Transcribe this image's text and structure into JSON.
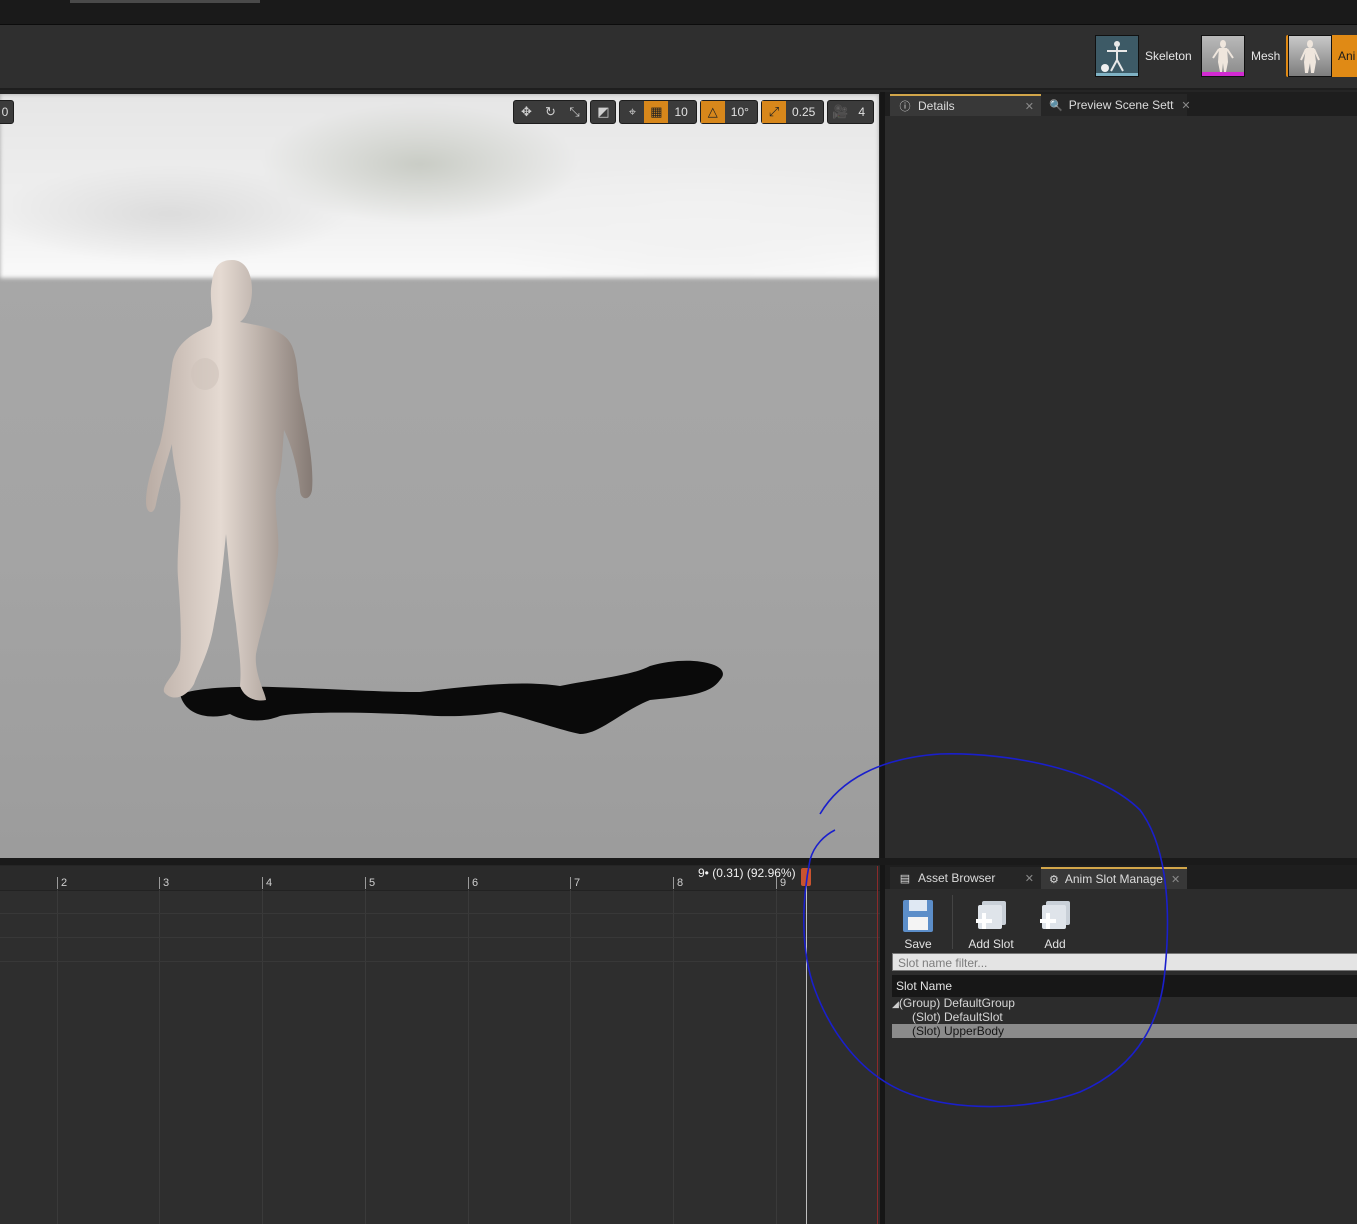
{
  "toolbar": {
    "modes": [
      {
        "label": "Skeleton",
        "icon": "skeleton-icon"
      },
      {
        "label": "Mesh",
        "icon": "mesh-icon"
      },
      {
        "label": "Ani",
        "icon": "animation-icon"
      }
    ]
  },
  "viewport": {
    "left_tag": "0",
    "grid_snap": "10",
    "rotation_snap": "10°",
    "scale_snap": "0.25",
    "camera_speed": "4"
  },
  "details_panel": {
    "tabs": [
      {
        "label": "Details",
        "icon": "info-icon"
      },
      {
        "label": "Preview Scene Sett",
        "icon": "search-icon"
      }
    ]
  },
  "timeline": {
    "ticks": [
      "2",
      "3",
      "4",
      "5",
      "6",
      "7",
      "8",
      "9"
    ],
    "frame_readout": "9• (0.31) (92.96%)"
  },
  "slot_panel": {
    "tabs": [
      {
        "label": "Asset Browser",
        "icon": "asset-browser-icon"
      },
      {
        "label": "Anim Slot Manage",
        "icon": "slot-manager-icon"
      }
    ],
    "buttons": {
      "save": "Save",
      "add_slot": "Add Slot",
      "add_group": "Add Group"
    },
    "filter_placeholder": "Slot name filter...",
    "column_header": "Slot Name",
    "tree": {
      "group": "(Group) DefaultGroup",
      "slots": [
        "(Slot) DefaultSlot",
        "(Slot) UpperBody"
      ]
    }
  },
  "colors": {
    "accent_orange": "#e08a15",
    "annotation_blue": "#1a1fcc",
    "selected_row": "#8b8b8b"
  }
}
